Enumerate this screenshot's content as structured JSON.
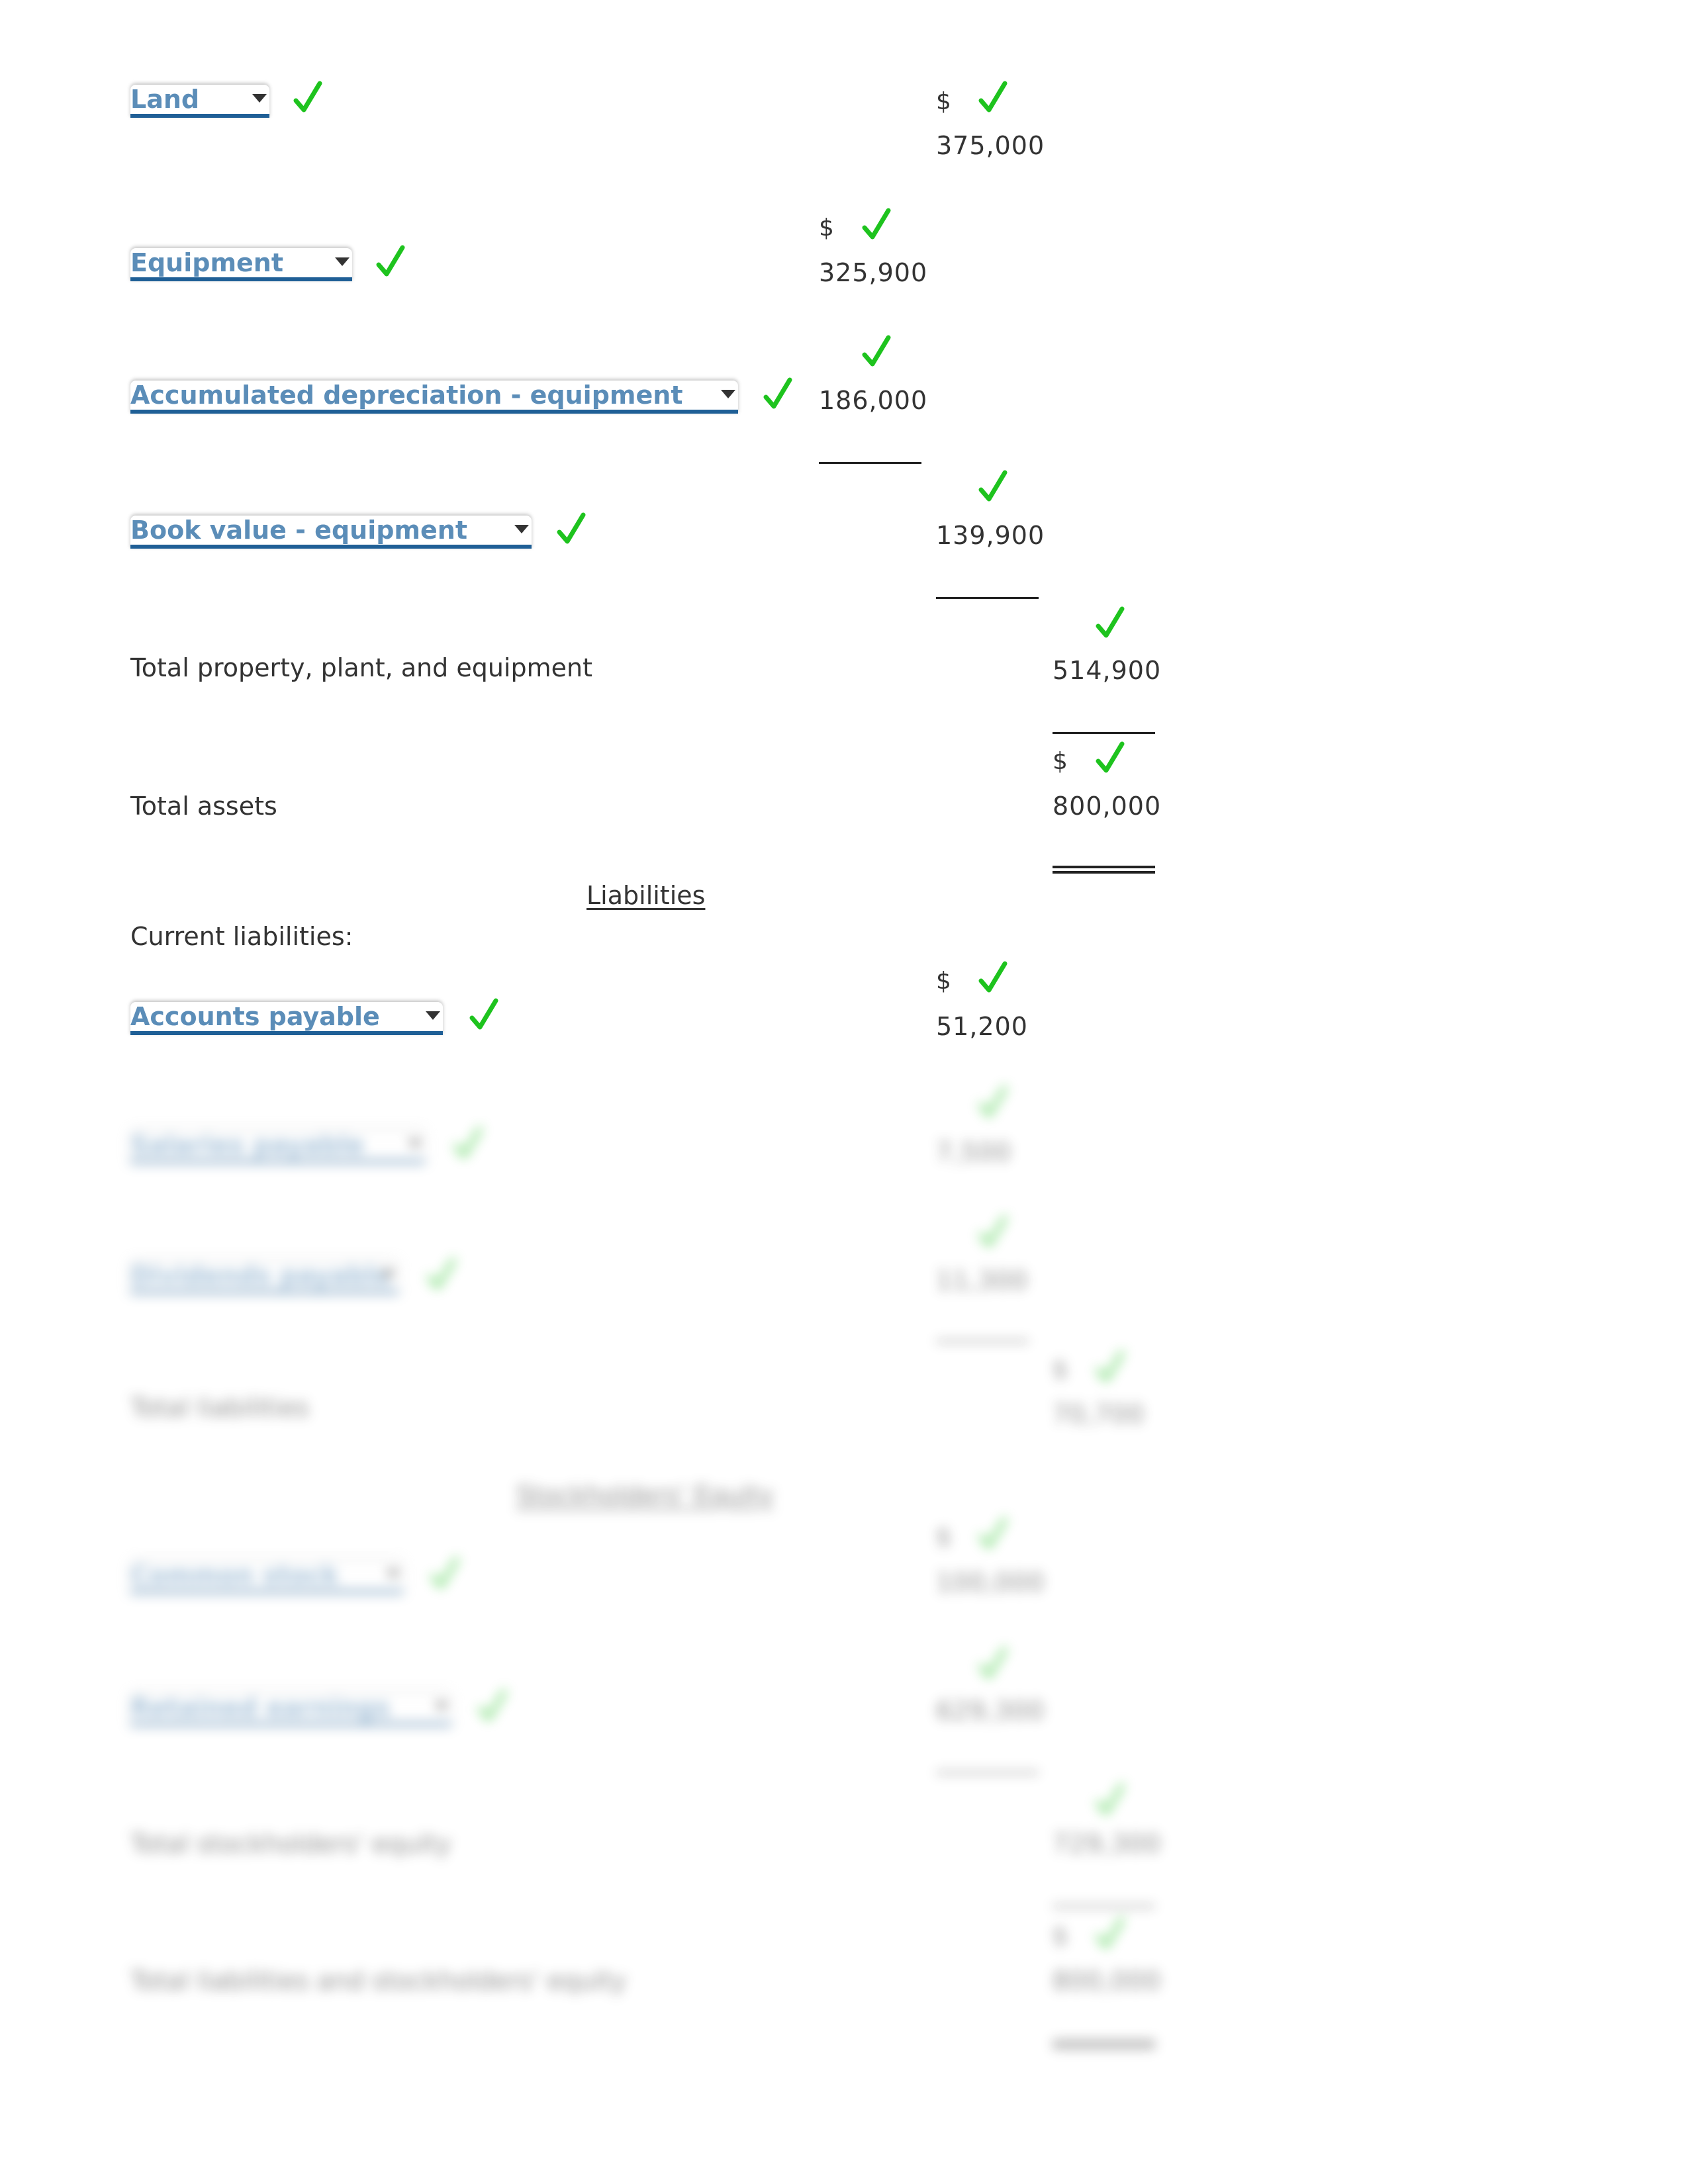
{
  "property_plant_equipment": {
    "land": {
      "account": "Land",
      "dollar_sign": "$",
      "amount": "375,000",
      "status": "correct"
    },
    "equipment": {
      "account": "Equipment",
      "dollar_sign": "$",
      "amount": "325,900",
      "status": "correct"
    },
    "accumulated_depreciation": {
      "account": "Accumulated depreciation - equipment",
      "amount": "186,000",
      "status": "correct"
    },
    "book_value": {
      "account": "Book value - equipment",
      "amount": "139,900",
      "status": "correct"
    },
    "total": {
      "label": "Total property, plant, and equipment",
      "amount": "514,900",
      "status": "correct"
    }
  },
  "total_assets": {
    "label": "Total assets",
    "dollar_sign": "$",
    "amount": "800,000",
    "status": "correct"
  },
  "liabilities": {
    "heading": "Liabilities",
    "current_label": "Current liabilities:",
    "accounts_payable": {
      "account": "Accounts payable",
      "dollar_sign": "$",
      "amount": "51,200",
      "status": "correct"
    }
  },
  "blurred_section": {
    "note": "obscured content",
    "rows": [
      {
        "account": "Salaries payable",
        "amount": "7,500"
      },
      {
        "account": "Dividends payable",
        "amount": "11,300"
      },
      {
        "label": "Total liabilities",
        "dollar_sign": "$",
        "amount": "70,700"
      },
      {
        "heading": "Stockholders' Equity"
      },
      {
        "account": "Common stock",
        "dollar_sign": "$",
        "amount": "100,000"
      },
      {
        "account": "Retained earnings",
        "amount": "629,300"
      },
      {
        "label": "Total stockholders' equity",
        "amount": "729,300"
      },
      {
        "label": "Total liabilities and stockholders' equity",
        "dollar_sign": "$",
        "amount": "800,000"
      }
    ]
  },
  "colors": {
    "check": "#1ec31e",
    "select_text": "#5b8db8",
    "select_underline": "#1f5f96",
    "text": "#333333"
  },
  "icons": {
    "check": "checkmark-icon",
    "caret": "caret-down-icon"
  }
}
